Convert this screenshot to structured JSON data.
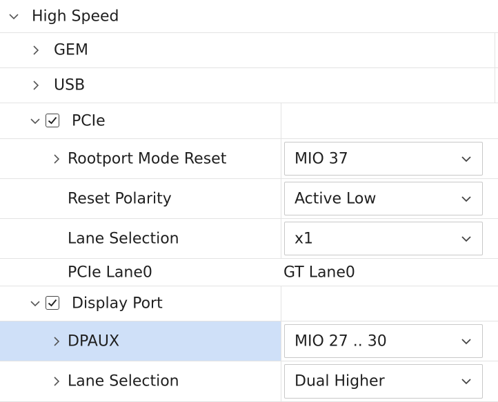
{
  "tree": {
    "high_speed": {
      "label": "High Speed"
    },
    "gem": {
      "label": "GEM"
    },
    "usb": {
      "label": "USB"
    },
    "pcie": {
      "label": "PCIe",
      "checked": true
    },
    "rootport_mode_reset": {
      "label": "Rootport Mode Reset",
      "value": "MIO 37"
    },
    "reset_polarity": {
      "label": "Reset Polarity",
      "value": "Active Low"
    },
    "pcie_lane_selection": {
      "label": "Lane Selection",
      "value": "x1"
    },
    "pcie_lane0": {
      "label": "PCIe Lane0",
      "value": "GT Lane0"
    },
    "display_port": {
      "label": "Display Port",
      "checked": true
    },
    "dpaux": {
      "label": "DPAUX",
      "value": "MIO 27 .. 30"
    },
    "dp_lane_selection": {
      "label": "Lane Selection",
      "value": "Dual Higher"
    }
  },
  "colors": {
    "selected_row": "#cfe0f8",
    "grid_line": "#e3e3e3"
  },
  "icons": {
    "expanded": "chevron-down-icon",
    "collapsed": "chevron-right-icon",
    "checkbox": "checkmark-icon",
    "dropdown": "chevron-down-icon"
  }
}
